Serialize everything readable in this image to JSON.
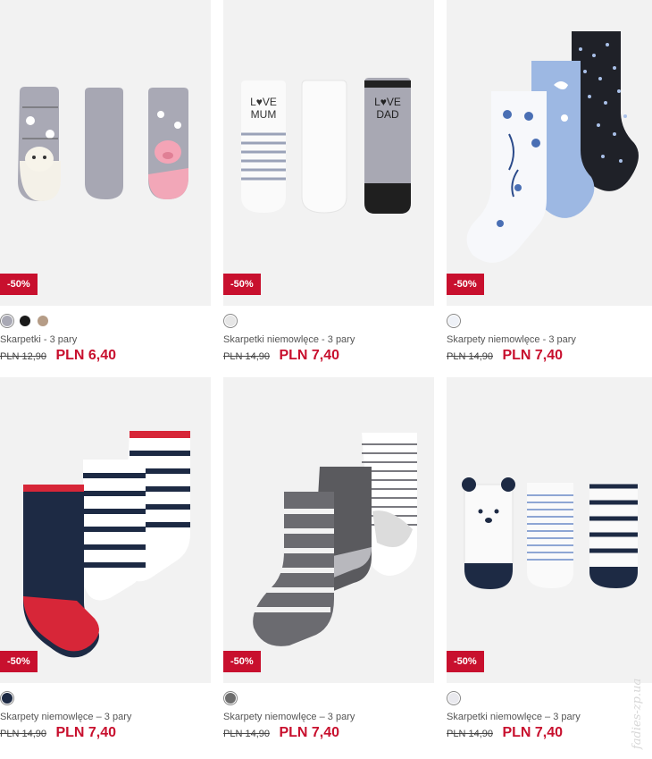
{
  "products": [
    {
      "name": "Skarpetki - 3 pary",
      "old_price": "PLN 12,90",
      "new_price": "PLN 6,40",
      "badge": "-50%",
      "swatches": [
        "#a9a9b5",
        "#1a1a1a",
        "#b59c86"
      ]
    },
    {
      "name": "Skarpetki niemowlęce - 3 pary",
      "old_price": "PLN 14,90",
      "new_price": "PLN 7,40",
      "badge": "-50%",
      "swatches": [
        "#e6e6e6"
      ],
      "sock_texts": [
        "LOVE\nMUM",
        "LOVE\nDAD"
      ]
    },
    {
      "name": "Skarpety niemowlęce - 3 pary",
      "old_price": "PLN 14,90",
      "new_price": "PLN 7,40",
      "badge": "-50%",
      "swatches": [
        "#eef1f7"
      ]
    },
    {
      "name": "Skarpety niemowlęce – 3 pary",
      "old_price": "PLN 14,90",
      "new_price": "PLN 7,40",
      "badge": "-50%",
      "swatches": [
        "#1d2a44"
      ]
    },
    {
      "name": "Skarpety niemowlęce – 3 pary",
      "old_price": "PLN 14,90",
      "new_price": "PLN 7,40",
      "badge": "-50%",
      "swatches": [
        "#6e6e6e"
      ]
    },
    {
      "name": "Skarpetki niemowlęce – 3 pary",
      "old_price": "PLN 14,90",
      "new_price": "PLN 7,40",
      "badge": "-50%",
      "swatches": [
        "#e9e9ee"
      ]
    }
  ],
  "colors": {
    "accent": "#c8102e",
    "image_bg": "#f2f2f2"
  },
  "watermark": "fadies-zp.ua"
}
